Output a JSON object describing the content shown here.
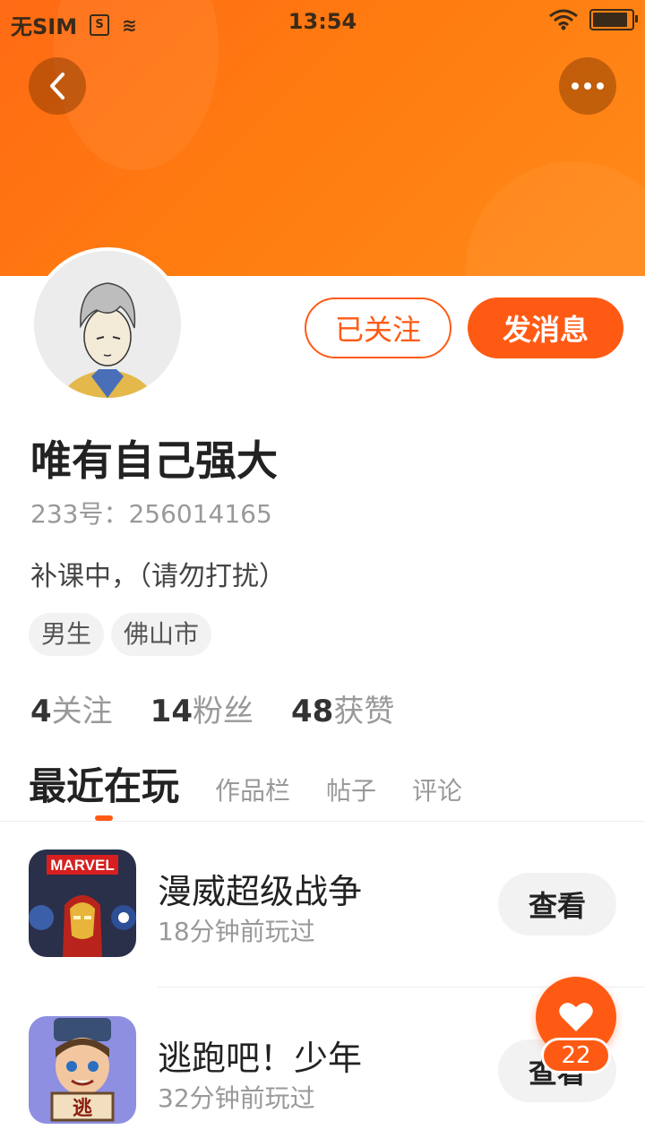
{
  "status_bar": {
    "carrier": "无SIM",
    "time": "13:54"
  },
  "nav": {
    "back_icon": "chevron-left-icon",
    "more_icon": "more-horizontal-icon"
  },
  "profile": {
    "follow_label": "已关注",
    "message_label": "发消息",
    "username": "唯有自己强大",
    "user_id": "233号：256014165",
    "bio": "补课中，（请勿打扰）",
    "tags": [
      "男生",
      "佛山市"
    ],
    "stats": [
      {
        "num": "4",
        "label": "关注"
      },
      {
        "num": "14",
        "label": "粉丝"
      },
      {
        "num": "48",
        "label": "获赞"
      }
    ]
  },
  "tabs": {
    "active": "最近在玩",
    "items": [
      "作品栏",
      "帖子",
      "评论"
    ]
  },
  "games": [
    {
      "name": "漫威超级战争",
      "time": "18分钟前玩过",
      "button": "查看",
      "icon_text": "MARVEL"
    },
    {
      "name": "逃跑吧！少年",
      "time": "32分钟前玩过",
      "button": "查看",
      "icon_text": "逃"
    }
  ],
  "fab": {
    "icon": "heart-icon",
    "count": "22"
  },
  "colors": {
    "accent": "#ff5a14",
    "banner": "#ff7d10"
  }
}
